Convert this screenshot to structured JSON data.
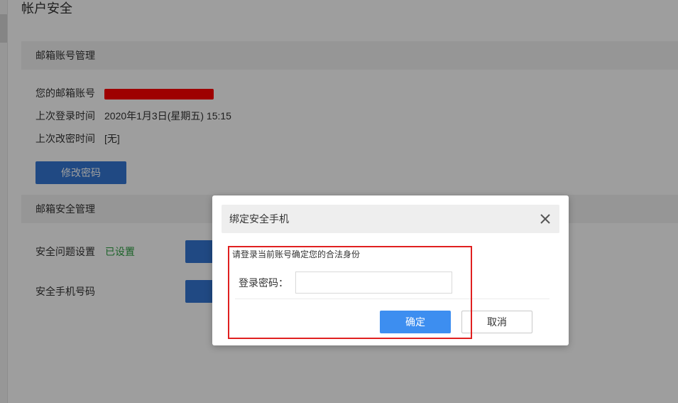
{
  "page": {
    "title": "帐户安全"
  },
  "mail_account_section": {
    "header": "邮箱账号管理",
    "rows": [
      {
        "label": "您的邮箱账号",
        "value": ""
      },
      {
        "label": "上次登录时间",
        "value": "2020年1月3日(星期五) 15:15"
      },
      {
        "label": "上次改密时间",
        "value": "[无]"
      }
    ],
    "change_password_button": "修改密码"
  },
  "mail_security_section": {
    "header": "邮箱安全管理",
    "security_question_label": "安全问题设置",
    "security_question_status": "已设置",
    "security_phone_label": "安全手机号码"
  },
  "dialog": {
    "title": "绑定安全手机",
    "hint": "请登录当前账号确定您的合法身份",
    "password_label": "登录密码：",
    "password_value": "",
    "confirm_button": "确定",
    "cancel_button": "取消"
  },
  "colors": {
    "primary": "#3477d4",
    "confirm": "#3d8ef0",
    "status_green": "#2ea043",
    "highlight_red": "#e02020",
    "redaction_red": "#ff0000"
  },
  "icons": {
    "close": "close-icon"
  }
}
